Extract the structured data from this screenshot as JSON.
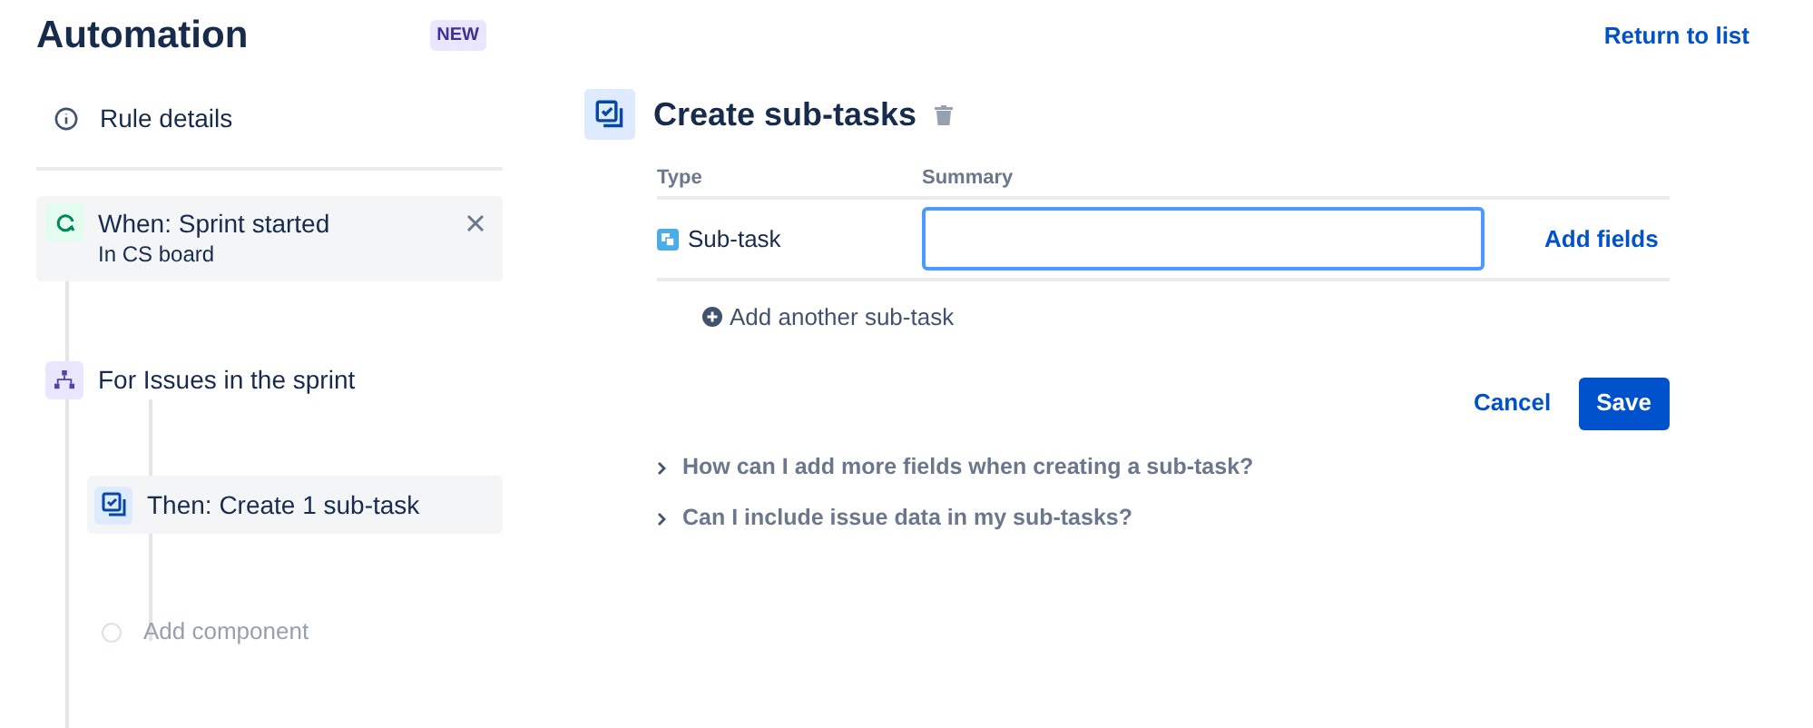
{
  "header": {
    "title": "Automation",
    "badge": "NEW",
    "link": "Return to list"
  },
  "sidebar": {
    "rule_details": "Rule details",
    "trigger": {
      "title": "When: Sprint started",
      "subtitle": "In CS board"
    },
    "branch": {
      "title": "For Issues in the sprint",
      "children": [
        {
          "kind": "action",
          "title": "Then: Create 1 sub-task",
          "selected": true
        },
        {
          "kind": "add",
          "title": "Add component",
          "selected": false
        }
      ]
    }
  },
  "panel": {
    "title": "Create sub-tasks",
    "table": {
      "columns": [
        "Type",
        "Summary"
      ],
      "rows": [
        {
          "type": "Sub-task",
          "action": "Add fields"
        }
      ]
    },
    "add_row": "Add another sub-task",
    "buttons": [
      {
        "label": "Cancel",
        "kind": "link"
      },
      {
        "label": "Save",
        "kind": "primary"
      }
    ],
    "faq": [
      {
        "question": "How can I add more fields when creating a sub-task?",
        "expanded": false
      },
      {
        "question": "Can I include issue data in my sub-tasks?",
        "expanded": false
      }
    ]
  }
}
